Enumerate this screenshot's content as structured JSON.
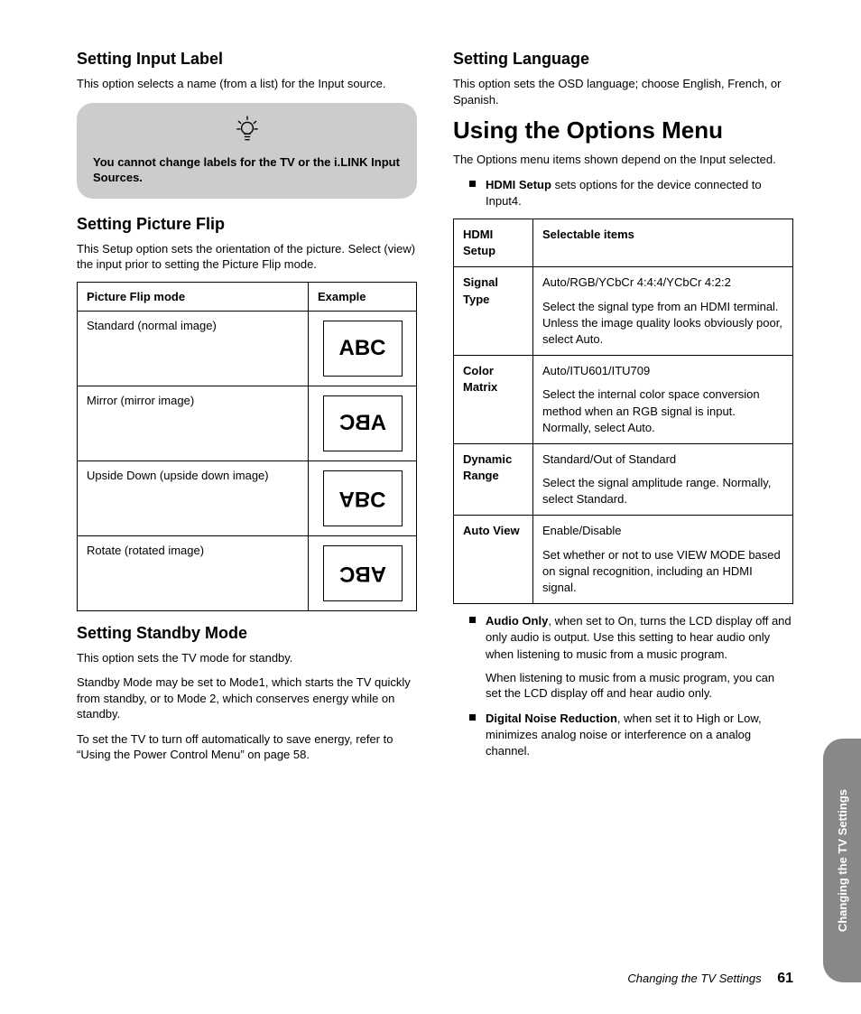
{
  "left": {
    "h_input_label": "Setting Input Label",
    "p_input_label": "This option selects a name (from a list) for the Input source.",
    "callout": "You cannot change labels for the TV or the i.LINK Input Sources.",
    "h_picture_flip": "Setting Picture Flip",
    "p_picture_flip": "This Setup option sets the orientation of the picture. Select (view) the input prior to setting the Picture Flip mode.",
    "flip_table": {
      "th_mode": "Picture Flip mode",
      "th_example": "Example",
      "rows": [
        {
          "label": "Standard (normal image)",
          "sample": "ABC",
          "cls": ""
        },
        {
          "label": "Mirror (mirror image)",
          "sample": "ABC",
          "cls": "mirror-h"
        },
        {
          "label": "Upside Down (upside down image)",
          "sample": "ABC",
          "cls": "flip-v"
        },
        {
          "label": "Rotate (rotated image)",
          "sample": "ABC",
          "cls": "rot180"
        }
      ]
    },
    "h_standby": "Setting Standby Mode",
    "p_standby_1": "This option sets the TV mode for standby.",
    "p_standby_2": "Standby Mode may be set to Mode1, which starts the TV quickly from standby, or to Mode 2, which conserves energy while on standby.",
    "p_standby_3": "To set the TV to turn off automatically to save energy, refer to “Using the Power Control Menu” on page 58."
  },
  "right": {
    "h_language": "Setting Language",
    "p_language": "This option sets the OSD language; choose English, French, or Spanish.",
    "h_options": "Using the Options Menu",
    "p_options": "The Options menu items shown depend on the Input selected.",
    "li_hdmi_bold": "HDMI Setup",
    "li_hdmi_rest": " sets options for the device connected to Input4.",
    "hdmi_table": {
      "th_col1": "HDMI Setup",
      "th_col2": "Selectable items",
      "rows": [
        {
          "name": "Signal Type",
          "opts": "Auto/RGB/YCbCr 4:4:4/YCbCr 4:2:2",
          "desc": "Select the signal type from an HDMI terminal. Unless the image quality looks obviously poor, select Auto."
        },
        {
          "name": "Color Matrix",
          "opts": "Auto/ITU601/ITU709",
          "desc": "Select the internal color space conversion method when an RGB signal is input. Normally, select Auto."
        },
        {
          "name": "Dynamic Range",
          "opts": "Standard/Out of Standard",
          "desc": "Select the signal amplitude range. Normally, select Standard."
        },
        {
          "name": "Auto View",
          "opts": "Enable/Disable",
          "desc": "Set whether or not to use VIEW MODE based on signal recognition, including an HDMI signal."
        }
      ]
    },
    "li_audio_bold": "Audio Only",
    "li_audio_rest": ", when set to On, turns the LCD display off and only audio is output. Use this setting to hear audio only when listening to music from a music program.",
    "li_audio_sub": "When listening to music from a music program, you can set the LCD display off and hear audio only.",
    "li_dnr_bold": "Digital Noise Reduction",
    "li_dnr_rest": ", when set it to High or Low, minimizes analog noise or interference on a analog channel."
  },
  "side_tab": "Changing the TV Settings",
  "footer_chapter": "Changing the TV Settings",
  "footer_page": "61"
}
